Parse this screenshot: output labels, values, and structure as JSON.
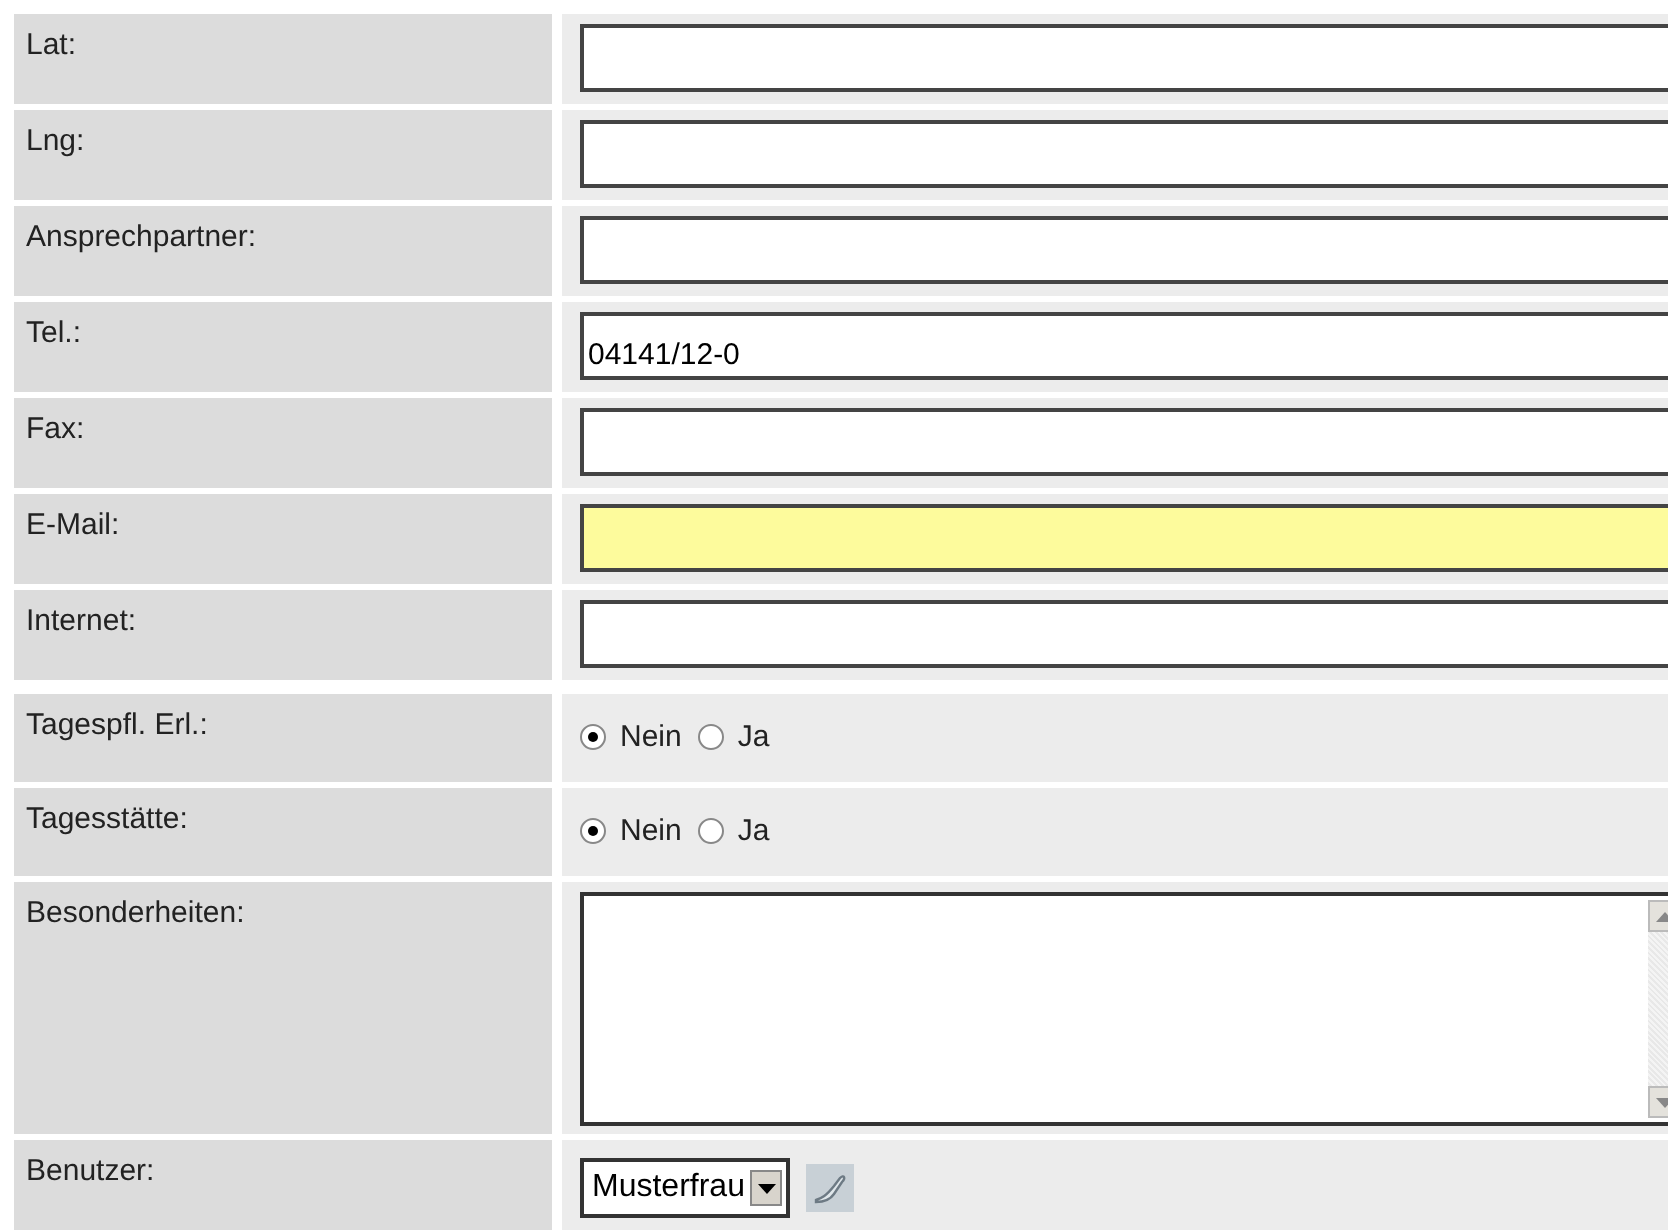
{
  "form": {
    "rows": [
      {
        "kind": "text",
        "label": "Lat:",
        "value": "",
        "highlighted": false
      },
      {
        "kind": "text",
        "label": "Lng:",
        "value": "",
        "highlighted": false
      },
      {
        "kind": "text",
        "label": "Ansprechpartner:",
        "value": "",
        "highlighted": false
      },
      {
        "kind": "text",
        "label": "Tel.:",
        "value": "04141/12-0",
        "highlighted": false
      },
      {
        "kind": "text",
        "label": "Fax:",
        "value": "",
        "highlighted": false
      },
      {
        "kind": "text",
        "label": "E-Mail:",
        "value": "",
        "highlighted": true
      },
      {
        "kind": "text",
        "label": "Internet:",
        "value": "",
        "highlighted": false
      },
      {
        "kind": "radio",
        "label": "Tagespfl. Erl.:",
        "options": [
          {
            "label": "Nein",
            "selected": true
          },
          {
            "label": "Ja",
            "selected": false
          }
        ]
      },
      {
        "kind": "radio",
        "label": "Tagesstätte:",
        "options": [
          {
            "label": "Nein",
            "selected": true
          },
          {
            "label": "Ja",
            "selected": false
          }
        ]
      },
      {
        "kind": "textarea",
        "label": "Besonderheiten:",
        "value": ""
      },
      {
        "kind": "select",
        "label": "Benutzer:",
        "value": "Musterfrau"
      }
    ]
  }
}
